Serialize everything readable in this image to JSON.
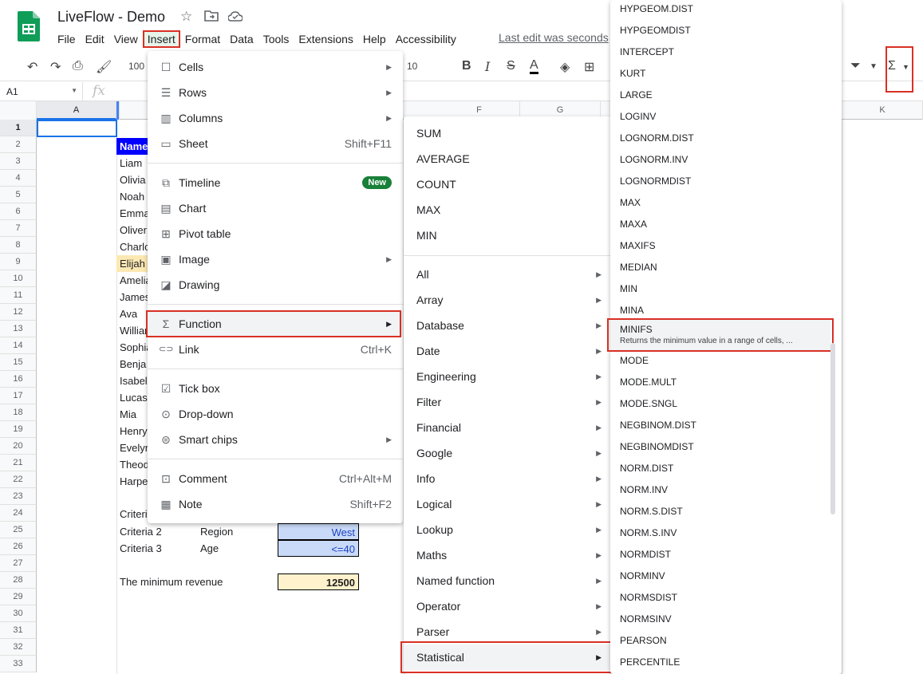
{
  "header": {
    "title": "LiveFlow - Demo",
    "last_edit": "Last edit was seconds",
    "menu": [
      "File",
      "Edit",
      "View",
      "Insert",
      "Format",
      "Data",
      "Tools",
      "Extensions",
      "Help",
      "Accessibility"
    ]
  },
  "toolbar": {
    "zoom": "100",
    "font_size": "10"
  },
  "formula_bar": {
    "cell_ref": "A1",
    "fx": "fx"
  },
  "grid": {
    "columns": [
      "A",
      "F",
      "G",
      "K"
    ],
    "rows": [
      "1",
      "2",
      "3",
      "4",
      "5",
      "6",
      "7",
      "8",
      "9",
      "10",
      "11",
      "12",
      "13",
      "14",
      "15",
      "16",
      "17",
      "18",
      "19",
      "20",
      "21",
      "22",
      "23",
      "24",
      "25",
      "26",
      "27",
      "28",
      "29",
      "30",
      "31",
      "32",
      "33"
    ],
    "names_header": "Name",
    "names": [
      "Liam",
      "Olivia",
      "Noah",
      "Emma",
      "Oliver",
      "Charlo",
      "Elijah",
      "Amelia",
      "James",
      "Ava",
      "William",
      "Sophia",
      "Benja",
      "Isabel",
      "Lucas",
      "Mia",
      "Henry",
      "Evelyn",
      "Theod",
      "Harpe"
    ],
    "criteria_1_label": "Criteri",
    "criteria_2_label": "Criteria 2",
    "criteria_2_field": "Region",
    "criteria_2_value": "West",
    "criteria_3_label": "Criteria 3",
    "criteria_3_field": "Age",
    "criteria_3_value": "<=40",
    "result_label": "The minimum revenue",
    "result_value": "12500"
  },
  "insert_menu": {
    "items": [
      {
        "label": "Cells",
        "icon": "cells-icon",
        "arrow": true
      },
      {
        "label": "Rows",
        "icon": "rows-icon",
        "arrow": true
      },
      {
        "label": "Columns",
        "icon": "columns-icon",
        "arrow": true
      },
      {
        "label": "Sheet",
        "icon": "sheet-icon",
        "shortcut": "Shift+F11"
      },
      {
        "label": "Timeline",
        "icon": "timeline-icon",
        "badge": "New"
      },
      {
        "label": "Chart",
        "icon": "chart-icon"
      },
      {
        "label": "Pivot table",
        "icon": "pivot-table-icon"
      },
      {
        "label": "Image",
        "icon": "image-icon",
        "arrow": true
      },
      {
        "label": "Drawing",
        "icon": "drawing-icon"
      },
      {
        "label": "Function",
        "icon": "sigma-icon",
        "arrow": true
      },
      {
        "label": "Link",
        "icon": "link-icon",
        "shortcut": "Ctrl+K"
      },
      {
        "label": "Tick box",
        "icon": "tick-box-icon"
      },
      {
        "label": "Drop-down",
        "icon": "dropdown-icon"
      },
      {
        "label": "Smart chips",
        "icon": "smart-chips-icon",
        "arrow": true
      },
      {
        "label": "Comment",
        "icon": "comment-icon",
        "shortcut": "Ctrl+Alt+M"
      },
      {
        "label": "Note",
        "icon": "note-icon",
        "shortcut": "Shift+F2"
      }
    ]
  },
  "function_menu": {
    "quick": [
      "SUM",
      "AVERAGE",
      "COUNT",
      "MAX",
      "MIN"
    ],
    "categories": [
      "All",
      "Array",
      "Database",
      "Date",
      "Engineering",
      "Filter",
      "Financial",
      "Google",
      "Info",
      "Logical",
      "Lookup",
      "Maths",
      "Named function",
      "Operator",
      "Parser",
      "Statistical"
    ]
  },
  "statistical_menu": {
    "items": [
      "HYPGEOM.DIST",
      "HYPGEOMDIST",
      "INTERCEPT",
      "KURT",
      "LARGE",
      "LOGINV",
      "LOGNORM.DIST",
      "LOGNORM.INV",
      "LOGNORMDIST",
      "MAX",
      "MAXA",
      "MAXIFS",
      "MEDIAN",
      "MIN",
      "MINA",
      "MINIFS",
      "MODE",
      "MODE.MULT",
      "MODE.SNGL",
      "NEGBINOM.DIST",
      "NEGBINOMDIST",
      "NORM.DIST",
      "NORM.INV",
      "NORM.S.DIST",
      "NORM.S.INV",
      "NORMDIST",
      "NORMINV",
      "NORMSDIST",
      "NORMSINV",
      "PEARSON",
      "PERCENTILE"
    ],
    "highlighted_desc": "Returns the minimum value in a range of cells, ..."
  },
  "colors": {
    "accent_red": "#d93025",
    "new_badge": "#188038",
    "name_header_bg": "#0000ff",
    "criteria_bg": "#c9daf8",
    "result_bg": "#fff2cc"
  }
}
